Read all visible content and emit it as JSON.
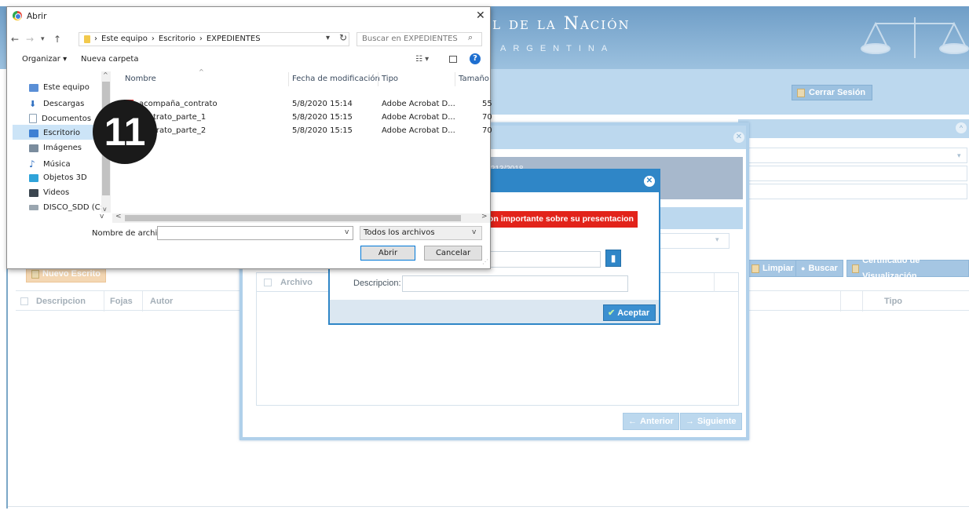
{
  "web": {
    "header_title": "l de la Nación",
    "header_subtitle": "ARGENTINA",
    "logout_label": "Cerrar Sesión",
    "new_writ_label": "Nuevo Escrito",
    "clear_label": "Limpiar",
    "search_label": "Buscar",
    "certificate_label": "Certificado de Visualización",
    "left_table_headers": [
      "Descripcion",
      "Fojas",
      "Autor"
    ],
    "right_table_headers": [
      "Tipo"
    ]
  },
  "case_modal": {
    "case_number": "/213/2018",
    "grid_headers": [
      "Archivo"
    ],
    "prev_label": "Anterior",
    "next_label": "Siguiente"
  },
  "upload_modal": {
    "warning_text": "on importante sobre su presentacion",
    "description_label": "Descripcion:",
    "description_value": "",
    "file_value": "",
    "accept_label": "Aceptar"
  },
  "file_dialog": {
    "title": "Abrir",
    "breadcrumb": [
      "Este equipo",
      "Escritorio",
      "EXPEDIENTES"
    ],
    "search_placeholder": "Buscar en EXPEDIENTES",
    "organize_label": "Organizar ▾",
    "new_folder_label": "Nueva carpeta",
    "nav_items": [
      {
        "label": "Este equipo",
        "icon": "computer-icon",
        "color": "#5a8fd6"
      },
      {
        "label": "Descargas",
        "icon": "download-icon",
        "color": "#2f6fc0"
      },
      {
        "label": "Documentos",
        "icon": "documents-icon",
        "color": "#8aa0b5"
      },
      {
        "label": "Escritorio",
        "icon": "desktop-icon",
        "color": "#3d7fd3"
      },
      {
        "label": "Imágenes",
        "icon": "pictures-icon",
        "color": "#7a8c9d"
      },
      {
        "label": "Música",
        "icon": "music-icon",
        "color": "#2f6fc0"
      },
      {
        "label": "Objetos 3D",
        "icon": "objects3d-icon",
        "color": "#2fa3d9"
      },
      {
        "label": "Videos",
        "icon": "videos-icon",
        "color": "#3b4650"
      },
      {
        "label": "DISCO_SDD (C:)",
        "icon": "drive-icon",
        "color": "#9aa6b0"
      }
    ],
    "columns": [
      "Nombre",
      "Fecha de modificación",
      "Tipo",
      "Tamaño"
    ],
    "files": [
      {
        "name": "acompaña_contrato",
        "modified": "5/8/2020 15:14",
        "type": "Adobe Acrobat D...",
        "size": "55"
      },
      {
        "name": "contrato_parte_1",
        "modified": "5/8/2020 15:15",
        "type": "Adobe Acrobat D...",
        "size": "70"
      },
      {
        "name": "contrato_parte_2",
        "modified": "5/8/2020 15:15",
        "type": "Adobe Acrobat D...",
        "size": "70"
      }
    ],
    "filename_label": "Nombre de archivo:",
    "filename_value": "",
    "filetype_value": "Todos los archivos",
    "open_label": "Abrir",
    "cancel_label": "Cancelar"
  },
  "step_marker": "11",
  "colors": {
    "accent": "#2f86c7",
    "warning": "#e2231a",
    "header": "#6f9ec7"
  }
}
